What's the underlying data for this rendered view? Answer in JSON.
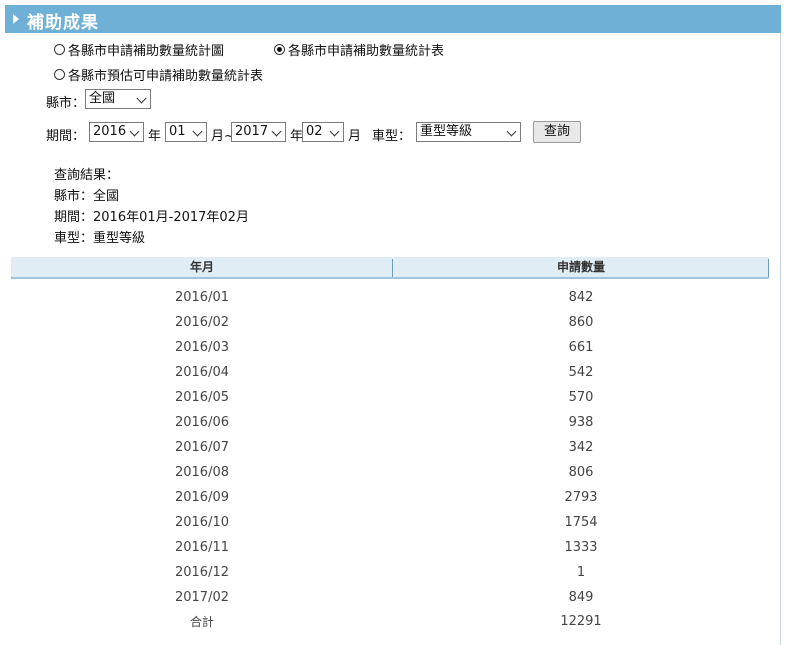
{
  "header": {
    "title": "補助成果"
  },
  "options": {
    "radio1": "各縣市申請補助數量統計圖",
    "radio2": "各縣市申請補助數量統計表",
    "radio3": "各縣市預估可申請補助數量統計表",
    "selected": "radio2"
  },
  "filters": {
    "county_label": "縣市：",
    "county_value": "全國",
    "period_label": "期間：",
    "start_year": "2016",
    "year_unit": "年",
    "start_month": "01",
    "month_tilde": "月~",
    "end_year": "2017",
    "end_month": "02",
    "month_unit": "月",
    "vehicle_label": "車型：",
    "vehicle_value": "重型等級",
    "query_button": "查詢"
  },
  "result": {
    "heading": "查詢結果：",
    "county": "縣市：全國",
    "period": "期間：2016年01月-2017年02月",
    "vehicle": "車型：重型等級"
  },
  "table": {
    "headers": [
      "年月",
      "申請數量"
    ],
    "rows": [
      [
        "2016/01",
        "842"
      ],
      [
        "2016/02",
        "860"
      ],
      [
        "2016/03",
        "661"
      ],
      [
        "2016/04",
        "542"
      ],
      [
        "2016/05",
        "570"
      ],
      [
        "2016/06",
        "938"
      ],
      [
        "2016/07",
        "342"
      ],
      [
        "2016/08",
        "806"
      ],
      [
        "2016/09",
        "2793"
      ],
      [
        "2016/10",
        "1754"
      ],
      [
        "2016/11",
        "1333"
      ],
      [
        "2016/12",
        "1"
      ],
      [
        "2017/02",
        "849"
      ]
    ],
    "total": [
      "合計",
      "12291"
    ]
  }
}
